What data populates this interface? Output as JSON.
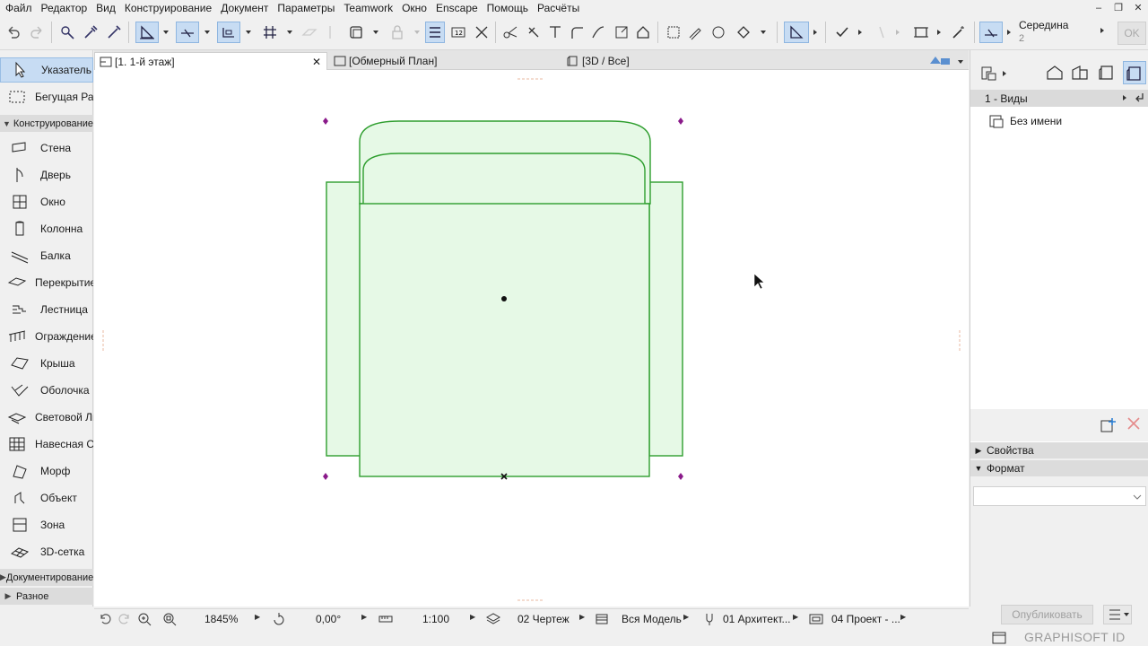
{
  "menu": [
    "Файл",
    "Редактор",
    "Вид",
    "Конструирование",
    "Документ",
    "Параметры",
    "Teamwork",
    "Окно",
    "Enscape",
    "Помощь",
    "Расчёты"
  ],
  "window_controls": [
    "–",
    "❐",
    "✕"
  ],
  "toolbar": {
    "snap_label": "Середина",
    "snap_sub": "2",
    "ok_label": "OK"
  },
  "toolbox": {
    "top_tools": [
      {
        "label": "Указатель",
        "icon": "arrow-pointer-icon",
        "selected": true
      },
      {
        "label": "Бегущая Рамка",
        "icon": "marquee-icon",
        "selected": false
      }
    ],
    "group_design": "Конструирование",
    "design_tools": [
      {
        "label": "Стена",
        "icon": "wall-icon"
      },
      {
        "label": "Дверь",
        "icon": "door-icon"
      },
      {
        "label": "Окно",
        "icon": "window-icon"
      },
      {
        "label": "Колонна",
        "icon": "column-icon"
      },
      {
        "label": "Балка",
        "icon": "beam-icon"
      },
      {
        "label": "Перекрытие",
        "icon": "slab-icon"
      },
      {
        "label": "Лестница",
        "icon": "stair-icon"
      },
      {
        "label": "Ограждение",
        "icon": "railing-icon"
      },
      {
        "label": "Крыша",
        "icon": "roof-icon"
      },
      {
        "label": "Оболочка",
        "icon": "shell-icon"
      },
      {
        "label": "Световой Люк",
        "icon": "skylight-icon"
      },
      {
        "label": "Навесная Стена",
        "icon": "curtain-wall-icon"
      },
      {
        "label": "Морф",
        "icon": "morph-icon"
      },
      {
        "label": "Объект",
        "icon": "object-icon"
      },
      {
        "label": "Зона",
        "icon": "zone-icon"
      },
      {
        "label": "3D-сетка",
        "icon": "mesh-icon"
      }
    ],
    "group_docs": "Документирование",
    "group_misc": "Разное"
  },
  "tabs": [
    {
      "label": "[1. 1-й этаж]",
      "icon": "floorplan-icon",
      "active": true,
      "close": "✕"
    },
    {
      "label": "[Обмерный План]",
      "icon": "layout-icon",
      "active": false
    },
    {
      "label": "[3D / Все]",
      "icon": "3d-icon",
      "active": false
    }
  ],
  "navigator": {
    "header": "1 - Виды",
    "tree_item": "Без имени",
    "properties": "Свойства",
    "format": "Формат",
    "publish": "Опубликовать"
  },
  "statusbar": {
    "zoom": "1845%",
    "angle": "0,00°",
    "scale": "1:100",
    "layers": "02 Чертеж",
    "model": "Вся Модель",
    "pen_set": "01 Архитект...",
    "renovation": "04 Проект - ..."
  },
  "brand": "GRAPHISOFT ID",
  "colors": {
    "accent": "#c7dcf3",
    "drawing_stroke": "#2e9e2e",
    "drawing_fill": "#e6f9e6",
    "hotspot": "#8a1a8a"
  }
}
